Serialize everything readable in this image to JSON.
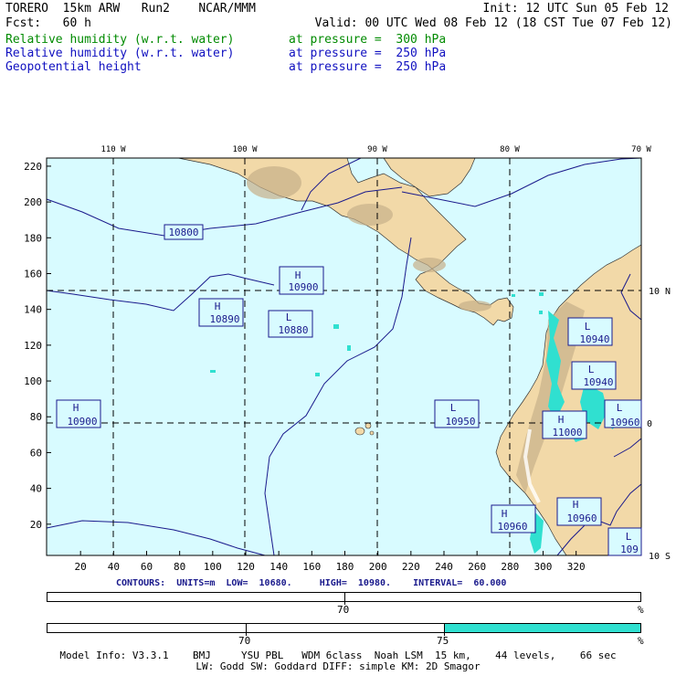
{
  "header": {
    "model": "TORERO  15km ARW   Run2    NCAR/MMM",
    "init": "Init: 12 UTC Sun 05 Feb 12",
    "fcst": "Fcst:   60 h",
    "valid": "Valid: 00 UTC Wed 08 Feb 12 (18 CST Tue 07 Feb 12)"
  },
  "fields": [
    {
      "name": "Relative humidity (w.r.t. water)",
      "level": "at pressure =  300 hPa",
      "color": "#008a00"
    },
    {
      "name": "Relative humidity (w.r.t. water)",
      "level": "at pressure =  250 hPa",
      "color": "#1010c0"
    },
    {
      "name": "Geopotential height",
      "level": "at pressure =  250 hPa",
      "color": "#000000"
    }
  ],
  "map": {
    "lon_labels": [
      "110 W",
      "100 W",
      "90 W",
      "80 W",
      "70 W"
    ],
    "lat_labels": [
      "10 N",
      "0",
      "10 S"
    ],
    "x_ticks": [
      "20",
      "40",
      "60",
      "80",
      "100",
      "120",
      "140",
      "160",
      "180",
      "200",
      "220",
      "240",
      "260",
      "280",
      "300",
      "320"
    ],
    "y_ticks": [
      "20",
      "40",
      "60",
      "80",
      "100",
      "120",
      "140",
      "160",
      "180",
      "200",
      "220"
    ],
    "colors": {
      "ocean": "#d8fbff",
      "land": "#f2d9a8",
      "moist": "#30e0d0",
      "contour": "#1a1a8c"
    },
    "contour_labels": [
      "10800",
      "10900",
      "10890",
      "10880",
      "10940",
      "10940",
      "10960",
      "10900",
      "10950",
      "11000",
      "10950",
      "10960",
      "109"
    ],
    "centers": [
      {
        "mark": "H",
        "value": "10900"
      },
      {
        "mark": "H",
        "value": "10890"
      },
      {
        "mark": "L",
        "value": "10880"
      },
      {
        "mark": "L",
        "value": "10940"
      },
      {
        "mark": "L",
        "value": "10940"
      },
      {
        "mark": "H",
        "value": "10960"
      },
      {
        "mark": "H",
        "value": "10900"
      },
      {
        "mark": "L",
        "value": "10950"
      },
      {
        "mark": "H",
        "value": "11000"
      },
      {
        "mark": "H",
        "value": "10960"
      },
      {
        "mark": "L",
        "value": "109"
      }
    ]
  },
  "contours_info": "CONTOURS:  UNITS=m  LOW=  10680.     HIGH=  10980.    INTERVAL=  60.000",
  "bar1": {
    "tick": "70",
    "unit": "%",
    "fill_from": null
  },
  "bar2": {
    "ticks": [
      "70",
      "75"
    ],
    "unit": "%",
    "fill_from": 75
  },
  "footer": {
    "line1": "Model Info: V3.3.1    BMJ     YSU PBL   WDM 6class  Noah LSM  15 km,    44 levels,    66 sec",
    "line2": "LW: Godd SW: Goddard DIFF: simple KM: 2D Smagor"
  }
}
